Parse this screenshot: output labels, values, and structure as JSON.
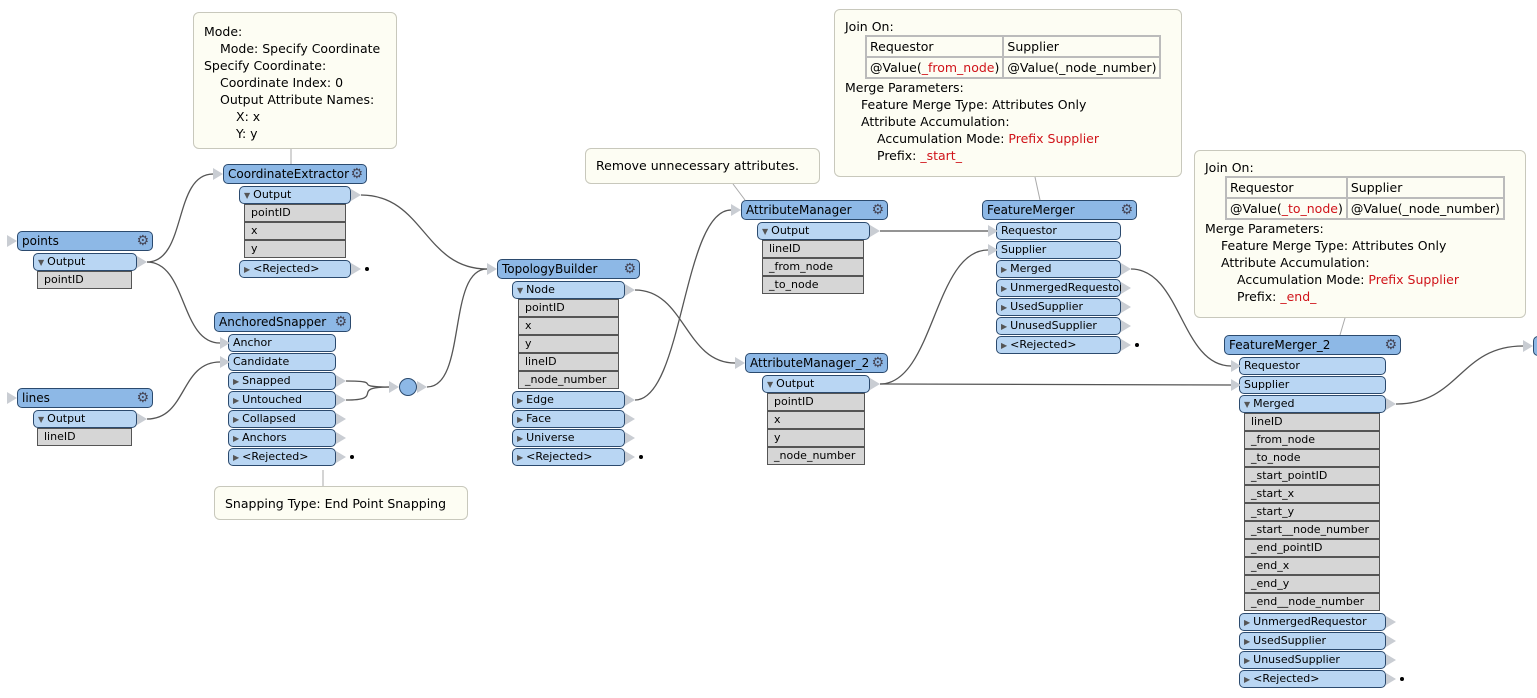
{
  "canvas": {
    "colors": {
      "header": "#8db8e6",
      "port": "#b9d6f3",
      "attribute": "#d6d6d6",
      "annotation": "#fdfdf3",
      "highlight": "#d0141a"
    }
  },
  "nodes": [
    {
      "id": "points",
      "name": "points",
      "header_input": true,
      "ports": [
        {
          "label": "Output",
          "dir": "out",
          "expand": "down",
          "attributes": [
            "pointID"
          ]
        }
      ]
    },
    {
      "id": "lines",
      "name": "lines",
      "header_input": true,
      "ports": [
        {
          "label": "Output",
          "dir": "out",
          "expand": "down",
          "attributes": [
            "lineID"
          ]
        }
      ]
    },
    {
      "id": "ce",
      "name": "CoordinateExtractor",
      "header_input": true,
      "ports": [
        {
          "label": "Output",
          "dir": "out",
          "expand": "down",
          "attributes": [
            "pointID",
            "x",
            "y"
          ]
        },
        {
          "label": "<Rejected>",
          "dir": "out",
          "expand": "right"
        }
      ]
    },
    {
      "id": "as",
      "name": "AnchoredSnapper",
      "header_input": false,
      "ports": [
        {
          "label": "Anchor",
          "dir": "in"
        },
        {
          "label": "Candidate",
          "dir": "in"
        },
        {
          "label": "Snapped",
          "dir": "out",
          "expand": "right"
        },
        {
          "label": "Untouched",
          "dir": "out",
          "expand": "right"
        },
        {
          "label": "Collapsed",
          "dir": "out",
          "expand": "right"
        },
        {
          "label": "Anchors",
          "dir": "out",
          "expand": "right"
        },
        {
          "label": "<Rejected>",
          "dir": "out",
          "expand": "right"
        }
      ]
    },
    {
      "id": "tb",
      "name": "TopologyBuilder",
      "header_input": true,
      "ports": [
        {
          "label": "Node",
          "dir": "out",
          "expand": "down",
          "attributes": [
            "pointID",
            "x",
            "y",
            "lineID",
            "_node_number"
          ]
        },
        {
          "label": "Edge",
          "dir": "out",
          "expand": "right"
        },
        {
          "label": "Face",
          "dir": "out",
          "expand": "right"
        },
        {
          "label": "Universe",
          "dir": "out",
          "expand": "right"
        },
        {
          "label": "<Rejected>",
          "dir": "out",
          "expand": "right"
        }
      ]
    },
    {
      "id": "am",
      "name": "AttributeManager",
      "header_input": true,
      "ports": [
        {
          "label": "Output",
          "dir": "out",
          "expand": "down",
          "attributes": [
            "lineID",
            "_from_node",
            "_to_node"
          ]
        }
      ]
    },
    {
      "id": "am2",
      "name": "AttributeManager_2",
      "header_input": true,
      "ports": [
        {
          "label": "Output",
          "dir": "out",
          "expand": "down",
          "attributes": [
            "pointID",
            "x",
            "y",
            "_node_number"
          ]
        }
      ]
    },
    {
      "id": "fm",
      "name": "FeatureMerger",
      "header_input": false,
      "ports": [
        {
          "label": "Requestor",
          "dir": "in"
        },
        {
          "label": "Supplier",
          "dir": "in"
        },
        {
          "label": "Merged",
          "dir": "out",
          "expand": "right"
        },
        {
          "label": "UnmergedRequestor",
          "dir": "out",
          "expand": "right"
        },
        {
          "label": "UsedSupplier",
          "dir": "out",
          "expand": "right"
        },
        {
          "label": "UnusedSupplier",
          "dir": "out",
          "expand": "right"
        },
        {
          "label": "<Rejected>",
          "dir": "out",
          "expand": "right"
        }
      ]
    },
    {
      "id": "fm2",
      "name": "FeatureMerger_2",
      "header_input": false,
      "ports": [
        {
          "label": "Requestor",
          "dir": "in"
        },
        {
          "label": "Supplier",
          "dir": "in"
        },
        {
          "label": "Merged",
          "dir": "out",
          "expand": "down",
          "attributes": [
            "lineID",
            "_from_node",
            "_to_node",
            "_start_pointID",
            "_start_x",
            "_start_y",
            "_start__node_number",
            "_end_pointID",
            "_end_x",
            "_end_y",
            "_end__node_number"
          ]
        },
        {
          "label": "UnmergedRequestor",
          "dir": "out",
          "expand": "right"
        },
        {
          "label": "UsedSupplier",
          "dir": "out",
          "expand": "right"
        },
        {
          "label": "UnusedSupplier",
          "dir": "out",
          "expand": "right"
        },
        {
          "label": "<Rejected>",
          "dir": "out",
          "expand": "right"
        }
      ]
    }
  ],
  "links": [
    {
      "from": "points.Output",
      "to": "ce.header"
    },
    {
      "from": "points.Output",
      "to": "as.Anchor"
    },
    {
      "from": "lines.Output",
      "to": "as.Candidate"
    },
    {
      "from": "ce.Output",
      "to": "tb.header"
    },
    {
      "from": "as.Snapped",
      "to": "junction.in"
    },
    {
      "from": "as.Untouched",
      "to": "junction.in"
    },
    {
      "from": "junction.out",
      "to": "tb.header"
    },
    {
      "from": "tb.Node",
      "to": "am2.header"
    },
    {
      "from": "tb.Edge",
      "to": "am.header"
    },
    {
      "from": "am.Output",
      "to": "fm.Requestor"
    },
    {
      "from": "am2.Output",
      "to": "fm.Supplier"
    },
    {
      "from": "am2.Output",
      "to": "fm2.Supplier"
    },
    {
      "from": "fm.Merged",
      "to": "fm2.Requestor"
    },
    {
      "from": "fm2.Merged",
      "to": "offscreen.header"
    }
  ],
  "annotations": {
    "coordinate_extractor": {
      "l0a": "Mode:",
      "l1a": "Mode: Specify Coordinate",
      "l0b": "Specify Coordinate:",
      "l1b": "Coordinate Index: 0",
      "l1c": "Output Attribute Names:",
      "l2a": "X: x",
      "l2b": "Y: y"
    },
    "attribute_manager": {
      "text": "Remove unnecessary attributes."
    },
    "anchored_snapper": {
      "text": "Snapping Type: End Point Snapping"
    },
    "feature_merger": {
      "join_on": "Join On:",
      "col1": "Requestor",
      "col2": "Supplier",
      "val1_prefix": "@Value(",
      "val1_attr": "_from_node",
      "val1_suffix": ")",
      "val2": "@Value(_node_number)",
      "merge_params": "Merge Parameters:",
      "merge_type": "Feature Merge Type: Attributes Only",
      "accum": "Attribute Accumulation:",
      "accum_mode_label": "Accumulation Mode: ",
      "accum_mode": "Prefix Supplier",
      "prefix_label": "Prefix: ",
      "prefix": "_start_"
    },
    "feature_merger_2": {
      "join_on": "Join On:",
      "col1": "Requestor",
      "col2": "Supplier",
      "val1_prefix": "@Value(",
      "val1_attr": "_to_node",
      "val1_suffix": ")",
      "val2": "@Value(_node_number)",
      "merge_params": "Merge Parameters:",
      "merge_type": "Feature Merge Type: Attributes Only",
      "accum": "Attribute Accumulation:",
      "accum_mode_label": "Accumulation Mode: ",
      "accum_mode": "Prefix Supplier",
      "prefix_label": "Prefix: ",
      "prefix": "_end_"
    }
  }
}
